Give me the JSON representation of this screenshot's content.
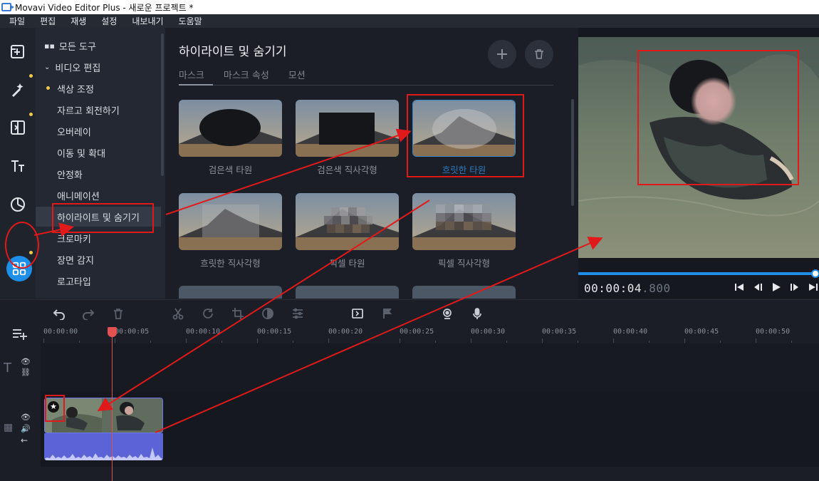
{
  "window": {
    "title": "Movavi Video Editor Plus - 새로운 프로젝트 *"
  },
  "menu": [
    "파일",
    "편집",
    "재생",
    "설정",
    "내보내기",
    "도움말"
  ],
  "rail": [
    {
      "name": "import-icon"
    },
    {
      "name": "magic-wand-icon"
    },
    {
      "name": "filters-icon"
    },
    {
      "name": "titles-icon"
    },
    {
      "name": "stickers-icon"
    },
    {
      "name": "more-tools-icon"
    }
  ],
  "tools": {
    "all_tools": "모든 도구",
    "video_edit": "비디오 편집",
    "items": [
      "색상 조정",
      "자르고 회전하기",
      "오버레이",
      "이동 및 확대",
      "안정화",
      "애니메이션",
      "하이라이트 및 숨기기",
      "크로마키",
      "장면 감지",
      "로고타입"
    ]
  },
  "panel": {
    "title": "하이라이트 및 숨기기",
    "tabs": [
      "마스크",
      "마스크 속성",
      "모션"
    ],
    "thumbs": [
      "검은색 타원",
      "검은색 직사각형",
      "흐릿한 타원",
      "흐릿한 직사각형",
      "픽셀 타원",
      "픽셀 직사각형"
    ]
  },
  "preview": {
    "timecode_main": "00:00:04",
    "timecode_ms": ".800",
    "progress": 0.985
  },
  "timeline": {
    "ticks": [
      "00:00:00",
      "00:00:05",
      "00:00:10",
      "00:00:15",
      "00:00:20",
      "00:00:25",
      "00:00:30",
      "00:00:35",
      "00:00:40",
      "00:00:45",
      "00:00:50"
    ]
  },
  "colors": {
    "accent": "#1e8fe8",
    "annotation": "#e01a1a",
    "playhead": "#e45151",
    "audio": "#5a64d6"
  }
}
